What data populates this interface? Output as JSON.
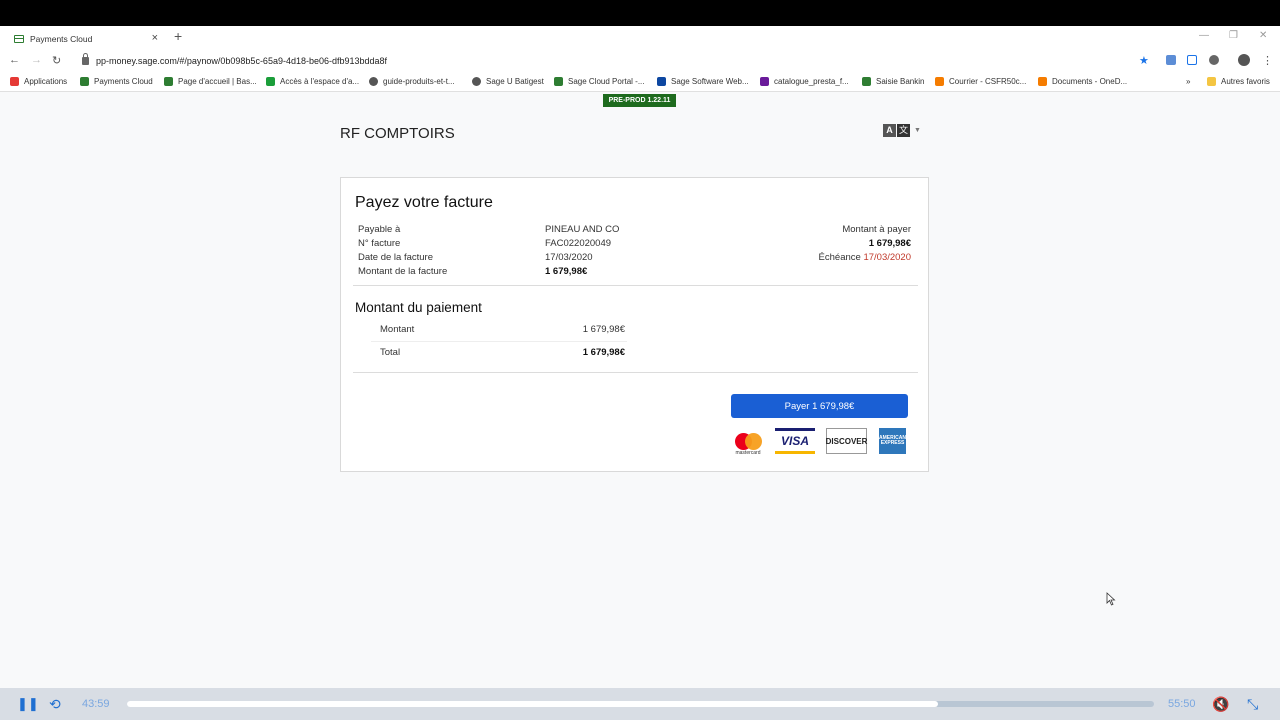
{
  "browser": {
    "tab_title": "Payments Cloud",
    "url": "pp-money.sage.com/#/paynow/0b098b5c-65a9-4d18-be06-dfb913bdda8f"
  },
  "bookmarks": [
    {
      "label": "Applications",
      "icon_color": "#e53935",
      "icon": "apps-grid-icon"
    },
    {
      "label": "Payments Cloud",
      "icon_color": "#2e7d32",
      "icon": "card-icon"
    },
    {
      "label": "Page d'accueil | Bas...",
      "icon_color": "#2e7d32",
      "icon": "sage-icon"
    },
    {
      "label": "Accès à l'espace d'a...",
      "icon_color": "#1b9e3a",
      "icon": "site-icon"
    },
    {
      "label": "guide-produits-et-t...",
      "icon_color": "#555555",
      "icon": "globe-icon"
    },
    {
      "label": "Sage U Batigest",
      "icon_color": "#555555",
      "icon": "globe-icon"
    },
    {
      "label": "Sage Cloud Portal -...",
      "icon_color": "#2e7d32",
      "icon": "sage-icon"
    },
    {
      "label": "Sage Software Web...",
      "icon_color": "#0d47a1",
      "icon": "sage-icon"
    },
    {
      "label": "catalogue_presta_f...",
      "icon_color": "#6a1b9a",
      "icon": "doc-icon"
    },
    {
      "label": "Saisie Bankin",
      "icon_color": "#2e7d32",
      "icon": "sage-icon"
    },
    {
      "label": "Courrier - CSFR50c...",
      "icon_color": "#f57c00",
      "icon": "windows-icon"
    },
    {
      "label": "Documents - OneD...",
      "icon_color": "#f57c00",
      "icon": "windows-icon"
    },
    {
      "label": "Autres favoris",
      "icon_color": "#f4c542",
      "icon": "folder-icon"
    }
  ],
  "page": {
    "env_badge": "PRE-PROD 1.22.11",
    "company": "RF COMPTOIRS",
    "invoice_title": "Payez votre facture",
    "fields": {
      "payable_label": "Payable à",
      "payable_value": "PINEAU AND CO",
      "number_label": "N° facture",
      "number_value": "FAC022020049",
      "date_label": "Date de la facture",
      "date_value": "17/03/2020",
      "amount_label": "Montant de la facture",
      "amount_value": "1 679,98€",
      "to_pay_label": "Montant à payer",
      "to_pay_value": "1 679,98€",
      "due_label": "Échéance",
      "due_value": "17/03/2020"
    },
    "payment": {
      "title": "Montant du paiement",
      "amount_label": "Montant",
      "amount_value": "1 679,98€",
      "total_label": "Total",
      "total_value": "1 679,98€"
    },
    "pay_button": "Payer 1 679,98€",
    "cards": {
      "mastercard": "mastercard",
      "visa": "VISA",
      "discover": "DISCOVER",
      "amex": "AMERICAN EXPRESS"
    }
  },
  "player": {
    "elapsed": "43:59",
    "total": "55:50",
    "progress": 0.79
  }
}
